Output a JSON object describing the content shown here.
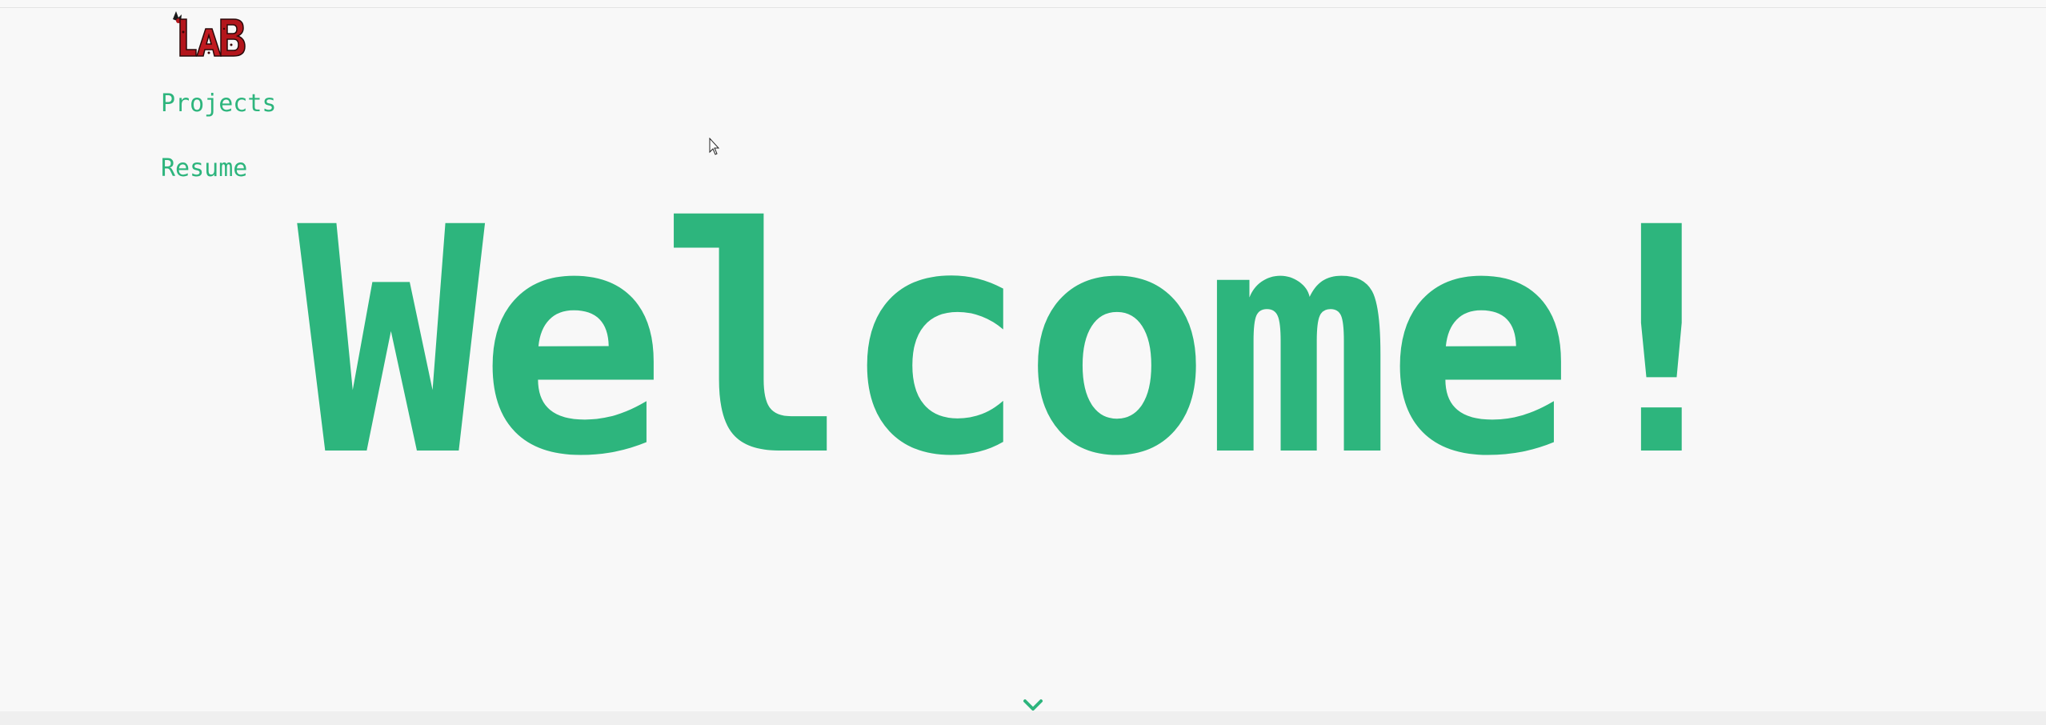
{
  "brand": {
    "logo_text": "LAB",
    "logo_icon": "red-lab-logo"
  },
  "nav": {
    "items": [
      {
        "label": "Projects"
      },
      {
        "label": "Resume"
      }
    ]
  },
  "hero": {
    "headline": "Welcome!"
  },
  "scroll": {
    "icon": "chevron-down-icon"
  },
  "colors": {
    "accent": "#2db57d",
    "background": "#f8f8f8",
    "logo_red": "#b3151b"
  }
}
